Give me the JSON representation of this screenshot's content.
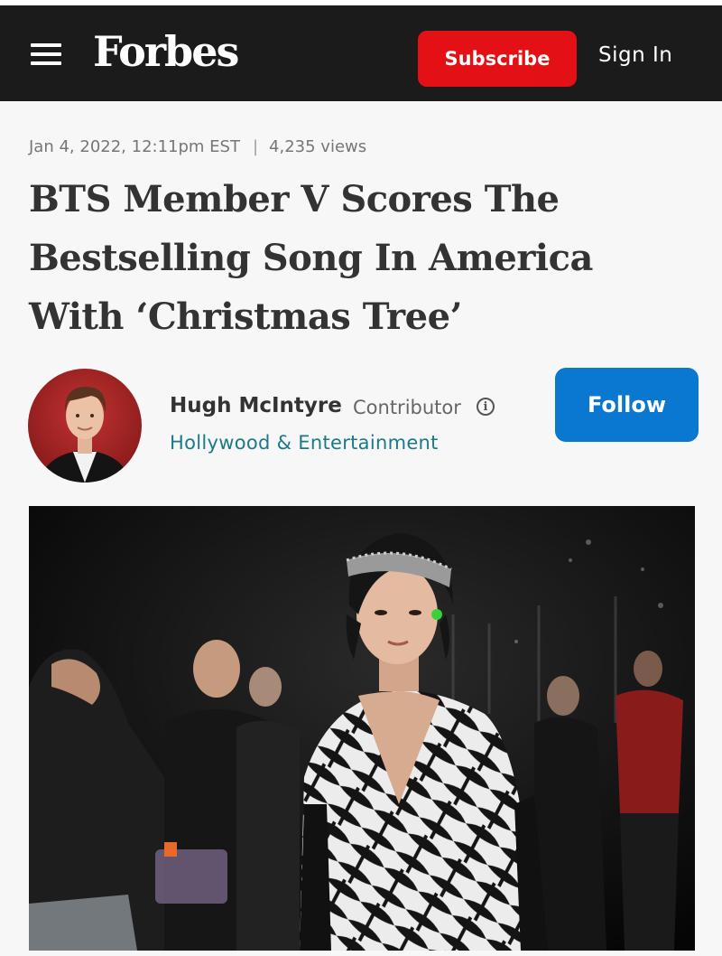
{
  "header": {
    "menu_icon": "hamburger-menu-icon",
    "logo": "Forbes",
    "subscribe_label": "Subscribe",
    "signin_label": "Sign In",
    "colors": {
      "bar": "#1b1b1b",
      "subscribe": "#e31015"
    }
  },
  "article": {
    "date": "Jan 4, 2022, 12:11pm EST",
    "separator": "|",
    "views": "4,235 views",
    "headline": "BTS Member V Scores The Bestselling Song In America With ‘Christmas Tree’"
  },
  "author": {
    "name": "Hugh McIntyre",
    "role": "Contributor",
    "info_icon": "info-circle-icon",
    "section": "Hollywood & Entertainment",
    "follow_label": "Follow",
    "colors": {
      "section": "#1a7a8a",
      "follow": "#0a77d0"
    }
  }
}
